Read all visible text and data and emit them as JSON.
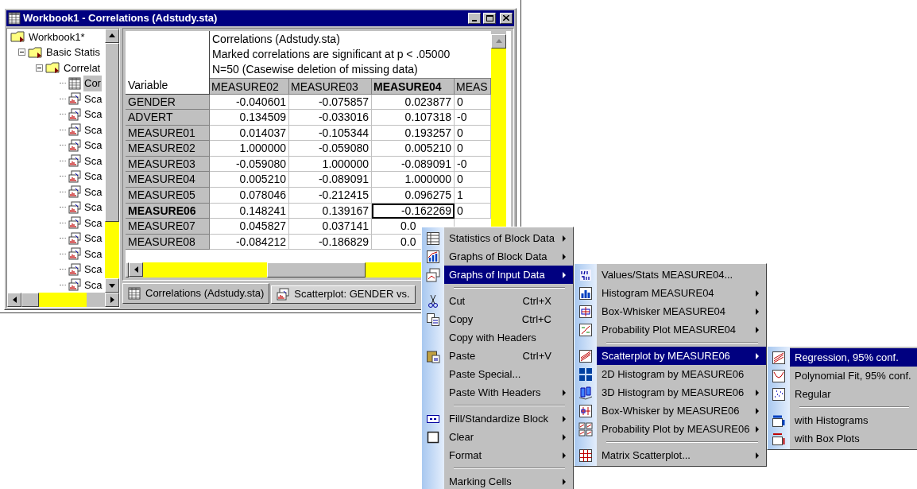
{
  "window": {
    "title": "Workbook1 - Correlations (Adstudy.sta)"
  },
  "tree": [
    {
      "label": "Workbook1*",
      "expanded": true,
      "children": [
        {
          "label": "Basic Statis",
          "expanded": true,
          "children": [
            {
              "label": "Correlat",
              "expanded": true,
              "children": [
                {
                  "label": "Cor",
                  "selected": true
                },
                {
                  "label": "Sca",
                  "selected": false
                },
                {
                  "label": "Sca",
                  "selected": false
                },
                {
                  "label": "Sca",
                  "selected": false
                },
                {
                  "label": "Sca",
                  "selected": false
                },
                {
                  "label": "Sca",
                  "selected": false
                },
                {
                  "label": "Sca",
                  "selected": false
                },
                {
                  "label": "Sca",
                  "selected": false
                },
                {
                  "label": "Sca",
                  "selected": false
                },
                {
                  "label": "Sca",
                  "selected": false
                },
                {
                  "label": "Sca",
                  "selected": false
                },
                {
                  "label": "Sca",
                  "selected": false
                },
                {
                  "label": "Sca",
                  "selected": false
                },
                {
                  "label": "Sca",
                  "selected": false
                }
              ]
            }
          ]
        }
      ]
    }
  ],
  "sheet": {
    "title_lines": [
      "Correlations (Adstudy.sta)",
      "Marked correlations are significant at p < .05000",
      "N=50 (Casewise deletion of missing data)"
    ],
    "corner": "Variable",
    "columns": [
      {
        "label": "MEASURE02",
        "current": false
      },
      {
        "label": "MEASURE03",
        "current": false
      },
      {
        "label": "MEASURE04",
        "current": true
      },
      {
        "label": "MEAS",
        "current": false
      }
    ],
    "rows": [
      {
        "label": "GENDER",
        "current": false,
        "cells": [
          "-0.040601",
          "-0.075857",
          "0.023877",
          "0"
        ]
      },
      {
        "label": "ADVERT",
        "current": false,
        "cells": [
          "0.134509",
          "-0.033016",
          "0.107318",
          "-0"
        ]
      },
      {
        "label": "MEASURE01",
        "current": false,
        "cells": [
          "0.014037",
          "-0.105344",
          "0.193257",
          "0"
        ]
      },
      {
        "label": "MEASURE02",
        "current": false,
        "cells": [
          "1.000000",
          "-0.059080",
          "0.005210",
          "0"
        ]
      },
      {
        "label": "MEASURE03",
        "current": false,
        "cells": [
          "-0.059080",
          "1.000000",
          "-0.089091",
          "-0"
        ]
      },
      {
        "label": "MEASURE04",
        "current": false,
        "cells": [
          "0.005210",
          "-0.089091",
          "1.000000",
          "0"
        ]
      },
      {
        "label": "MEASURE05",
        "current": false,
        "cells": [
          "0.078046",
          "-0.212415",
          "0.096275",
          "1"
        ]
      },
      {
        "label": "MEASURE06",
        "current": true,
        "cells": [
          "0.148241",
          "0.139167",
          "-0.162269",
          "0"
        ]
      },
      {
        "label": "MEASURE07",
        "current": false,
        "cells": [
          "0.045827",
          "0.037141",
          "0.0",
          null
        ]
      },
      {
        "label": "MEASURE08",
        "current": false,
        "cells": [
          "-0.084212",
          "-0.186829",
          "0.0",
          null
        ]
      }
    ]
  },
  "tabs": [
    {
      "label": "Correlations (Adstudy.sta)",
      "selected": true
    },
    {
      "label": "Scatterplot: GENDER  vs.",
      "selected": false
    }
  ],
  "context_menu": [
    {
      "kind": "item",
      "label": "Statistics of Block Data",
      "submenu": true,
      "selected": false
    },
    {
      "kind": "item",
      "label": "Graphs of Block Data",
      "submenu": true,
      "selected": false
    },
    {
      "kind": "item",
      "label": "Graphs of Input Data",
      "submenu": true,
      "selected": true
    },
    {
      "kind": "separator"
    },
    {
      "kind": "item",
      "label": "Cut",
      "shortcut": "Ctrl+X",
      "submenu": false,
      "selected": false
    },
    {
      "kind": "item",
      "label": "Copy",
      "shortcut": "Ctrl+C",
      "submenu": false,
      "selected": false
    },
    {
      "kind": "item",
      "label": "Copy with Headers",
      "submenu": false,
      "selected": false
    },
    {
      "kind": "item",
      "label": "Paste",
      "shortcut": "Ctrl+V",
      "submenu": false,
      "selected": false
    },
    {
      "kind": "item",
      "label": "Paste Special...",
      "submenu": false,
      "selected": false
    },
    {
      "kind": "item",
      "label": "Paste With Headers",
      "submenu": true,
      "selected": false
    },
    {
      "kind": "separator"
    },
    {
      "kind": "item",
      "label": "Fill/Standardize Block",
      "submenu": true,
      "selected": false
    },
    {
      "kind": "item",
      "label": "Clear",
      "submenu": true,
      "selected": false
    },
    {
      "kind": "item",
      "label": "Format",
      "submenu": true,
      "selected": false
    },
    {
      "kind": "separator"
    },
    {
      "kind": "item",
      "label": "Marking Cells",
      "submenu": true,
      "selected": false
    }
  ],
  "submenu": [
    {
      "kind": "item",
      "label": "Values/Stats MEASURE04...",
      "submenu": false,
      "selected": false
    },
    {
      "kind": "item",
      "label": "Histogram MEASURE04",
      "submenu": true,
      "selected": false
    },
    {
      "kind": "item",
      "label": "Box-Whisker MEASURE04",
      "submenu": true,
      "selected": false
    },
    {
      "kind": "item",
      "label": "Probability Plot MEASURE04",
      "submenu": true,
      "selected": false
    },
    {
      "kind": "separator"
    },
    {
      "kind": "item",
      "label": "Scatterplot by MEASURE06",
      "submenu": true,
      "selected": true
    },
    {
      "kind": "item",
      "label": "2D Histogram by MEASURE06",
      "submenu": false,
      "selected": false
    },
    {
      "kind": "item",
      "label": "3D Histogram by MEASURE06",
      "submenu": true,
      "selected": false
    },
    {
      "kind": "item",
      "label": "Box-Whisker by MEASURE06",
      "submenu": true,
      "selected": false
    },
    {
      "kind": "item",
      "label": "Probability Plot by MEASURE06",
      "submenu": true,
      "selected": false
    },
    {
      "kind": "separator"
    },
    {
      "kind": "item",
      "label": "Matrix Scatterplot...",
      "submenu": true,
      "selected": false
    }
  ],
  "subsubmenu": [
    {
      "kind": "item",
      "label": "Regression, 95% conf.",
      "submenu": false,
      "selected": true
    },
    {
      "kind": "item",
      "label": "Polynomial Fit, 95% conf.",
      "submenu": false,
      "selected": false
    },
    {
      "kind": "item",
      "label": "Regular",
      "submenu": false,
      "selected": false
    },
    {
      "kind": "separator"
    },
    {
      "kind": "item",
      "label": "with Histograms",
      "submenu": false,
      "selected": false
    },
    {
      "kind": "item",
      "label": "with Box Plots",
      "submenu": false,
      "selected": false
    }
  ]
}
